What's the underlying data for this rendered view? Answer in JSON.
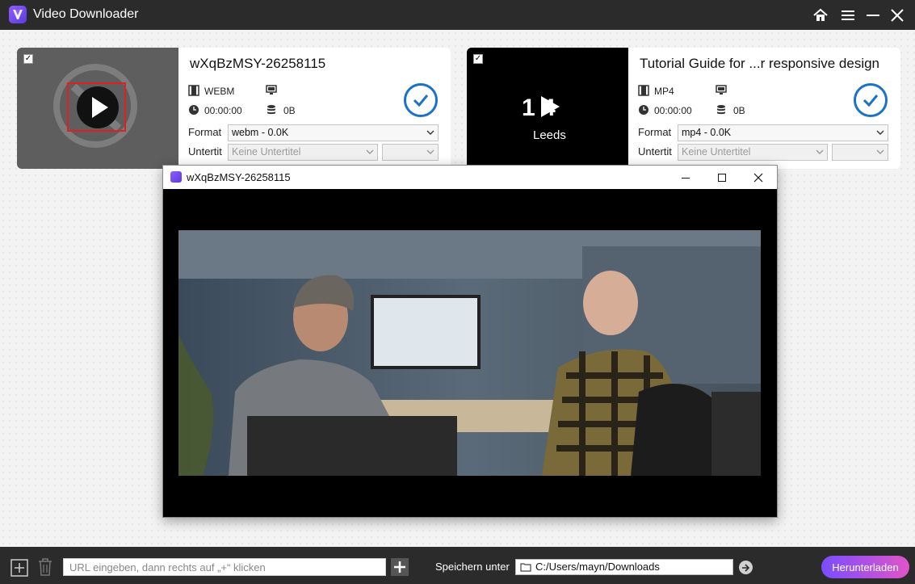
{
  "app": {
    "title": "Video Downloader"
  },
  "cards": [
    {
      "title": "wXqBzMSY-26258115",
      "format_type": "WEBM",
      "duration": "00:00:00",
      "size": "0B",
      "format_label": "Format",
      "format_value": "webm - 0.0K",
      "subtitle_label": "Untertit",
      "subtitle_value": "Keine Untertitel",
      "checked": true,
      "status": "done"
    },
    {
      "title": "Tutorial Guide for ...r responsive design",
      "format_type": "MP4",
      "duration": "00:00:00",
      "size": "0B",
      "format_label": "Format",
      "format_value": "mp4 - 0.0K",
      "subtitle_label": "Untertit",
      "subtitle_value": "Keine Untertitel",
      "thumb_text_top": "1 4",
      "thumb_text_bottom": "Leeds",
      "checked": true,
      "status": "done"
    }
  ],
  "player": {
    "title": "wXqBzMSY-26258115"
  },
  "footer": {
    "url_placeholder": "URL eingeben, dann rechts auf „+“ klicken",
    "save_label": "Speichern unter",
    "save_path": "C:/Users/mayn/Downloads",
    "download_label": "Herunterladen"
  },
  "icons": [
    "home-icon",
    "menu-icon",
    "minimize-icon",
    "close-icon",
    "play-icon",
    "film-icon",
    "monitor-icon",
    "clock-icon",
    "database-icon",
    "check-circle-icon",
    "chevron-down-icon",
    "plus-icon",
    "trash-icon",
    "folder-icon",
    "arrow-right-icon",
    "maximize-icon"
  ],
  "colors": {
    "accent": "#1b72c8",
    "titlebar": "#2b2b2b",
    "download_gradient_start": "#7a4dff",
    "download_gradient_end": "#e055c8"
  }
}
